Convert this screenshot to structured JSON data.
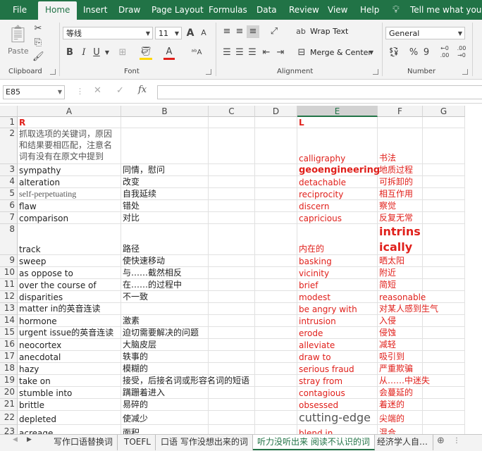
{
  "menu": {
    "file": "File",
    "home": "Home",
    "insert": "Insert",
    "draw": "Draw",
    "page_layout": "Page Layout",
    "formulas": "Formulas",
    "data": "Data",
    "review": "Review",
    "view": "View",
    "help": "Help",
    "tell_me": "Tell me what you want"
  },
  "ribbon": {
    "clipboard": {
      "paste": "Paste",
      "label": "Clipboard"
    },
    "font": {
      "name": "等线",
      "size": "11",
      "label": "Font",
      "bold": "B",
      "italic": "I",
      "underline": "U",
      "grow": "A",
      "shrink": "A"
    },
    "alignment": {
      "wrap_text": "Wrap Text",
      "merge_center": "Merge & Center",
      "label": "Alignment"
    },
    "number": {
      "format": "General",
      "label": "Number",
      "percent": "%",
      "comma": "9",
      "inc_decimal": "←0\n.00",
      "dec_decimal": ".00\n→0"
    }
  },
  "formula_bar": {
    "name_box": "E85",
    "fx": "fx",
    "cancel": "✕",
    "enter": "✓",
    "content": ""
  },
  "columns": [
    "A",
    "B",
    "C",
    "D",
    "E",
    "F",
    "G"
  ],
  "selected_column": "E",
  "rows": [
    {
      "num": "1",
      "A": "R",
      "B": "",
      "E": "L",
      "F": ""
    },
    {
      "num": "2",
      "A": "抓取选项的关键词，原因和结果要相匹配，注意名词有没有在原文中提到",
      "B": "",
      "E": "calligraphy",
      "F": "书法"
    },
    {
      "num": "3",
      "A": "sympathy",
      "B": "同情，慰问",
      "E": "geoengineering",
      "F": "地质过程"
    },
    {
      "num": "4",
      "A": "alteration",
      "B": "改变",
      "E": "detachable",
      "F": "可拆卸的"
    },
    {
      "num": "5",
      "A": "self-perpetuating",
      "B": "自我延续",
      "E": "reciprocity",
      "F": "相互作用"
    },
    {
      "num": "6",
      "A": "flaw",
      "B": "错处",
      "E": "discern",
      "F": "察觉"
    },
    {
      "num": "7",
      "A": "comparison",
      "B": "对比",
      "E": "capricious",
      "F": "反复无常"
    },
    {
      "num": "8",
      "A": "track",
      "B": "路径",
      "E": "内在的",
      "F": "intrinsically"
    },
    {
      "num": "9",
      "A": "sweep",
      "B": "使快速移动",
      "E": "basking",
      "F": "晒太阳"
    },
    {
      "num": "10",
      "A": "as oppose to",
      "B": "与……截然相反",
      "E": "vicinity",
      "F": "附近"
    },
    {
      "num": "11",
      "A": "over the course of",
      "B": "在……的过程中",
      "E": "brief",
      "F": "简短"
    },
    {
      "num": "12",
      "A": "disparities",
      "B": "不一致",
      "E": "modest",
      "F": "reasonable"
    },
    {
      "num": "13",
      "A": "matter in的英音连读",
      "B": "",
      "E": "be angry with",
      "F": "对某人感到生气"
    },
    {
      "num": "14",
      "A": "hormone",
      "B": "激素",
      "E": "intrusion",
      "F": "入侵"
    },
    {
      "num": "15",
      "A": "urgent issue的英音连读",
      "B": "迫切需要解决的问题",
      "E": "erode",
      "F": "侵蚀"
    },
    {
      "num": "16",
      "A": "neocortex",
      "B": "大脑皮层",
      "E": "alleviate",
      "F": "减轻"
    },
    {
      "num": "17",
      "A": "anecdotal",
      "B": "轶事的",
      "E": "draw to",
      "F": "吸引到"
    },
    {
      "num": "18",
      "A": "hazy",
      "B": "模糊的",
      "E": "serious fraud",
      "F": "严重欺骗"
    },
    {
      "num": "19",
      "A": "take on",
      "B": "接受，后接名词或形容名词的短语",
      "E": "stray from",
      "F": "从……中迷失"
    },
    {
      "num": "20",
      "A": "stumble into",
      "B": "蹒跚着进入",
      "E": "contagious",
      "F": "会蔓延的"
    },
    {
      "num": "21",
      "A": "brittle",
      "B": "易碎的",
      "E": "obsessed",
      "F": "着迷的"
    },
    {
      "num": "22",
      "A": "depleted",
      "B": "使减少",
      "E": "cutting-edge",
      "F": "尖端的"
    },
    {
      "num": "23",
      "A": "acreage",
      "B": "面积",
      "E": "blend in",
      "F": "混合"
    }
  ],
  "sheet_tabs": [
    "写作口语替换词",
    "TOEFL",
    "口语 写作没想出来的词",
    "听力没听出来 阅读不认识的词",
    "经济学人自…"
  ],
  "active_sheet": "听力没听出来 阅读不认识的词",
  "colors": {
    "brand": "#217346",
    "red_text": "#e0201b"
  }
}
